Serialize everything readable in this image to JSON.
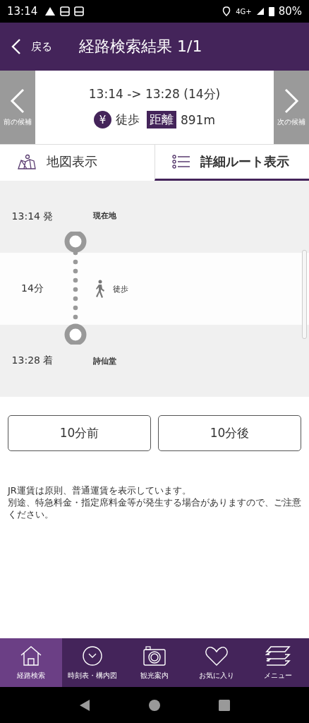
{
  "status_bar": {
    "time": "13:14",
    "network": "4G+",
    "battery": "80%"
  },
  "header": {
    "back": "戻る",
    "title": "経路検索結果 1/1"
  },
  "summary": {
    "prev": "前の候補",
    "next": "次の候補",
    "times": "13:14 -> 13:28 (14分)",
    "fare_icon": "¥",
    "mode": "徒歩",
    "distance_label": "距離",
    "distance": "891m"
  },
  "tabs": [
    {
      "label": "地図表示",
      "kind": "map",
      "selected": false
    },
    {
      "label": "詳細ルート表示",
      "kind": "list",
      "selected": true
    }
  ],
  "timeline": [
    {
      "kind": "stop",
      "time": "13:14 発",
      "place": "現在地"
    },
    {
      "kind": "walk",
      "time": "14分",
      "label": "徒歩"
    },
    {
      "kind": "stop",
      "time": "13:28 着",
      "place": "詩仙堂"
    }
  ],
  "buttons": [
    "10分前",
    "10分後"
  ],
  "notes": [
    "JR運賃は原則、普通運賃を表示しています。",
    "別途、特急料金・指定席料金等が発生する場合がありますので、ご注意ください。"
  ],
  "nav": [
    {
      "label": "経路検索",
      "kind": "home",
      "selected": true
    },
    {
      "label": "時刻表・構内図",
      "kind": "clock",
      "selected": false
    },
    {
      "label": "観光案内",
      "kind": "camera",
      "selected": false
    },
    {
      "label": "お気に入り",
      "kind": "heart",
      "selected": false
    },
    {
      "label": "メニュー",
      "kind": "layers",
      "selected": false
    }
  ]
}
